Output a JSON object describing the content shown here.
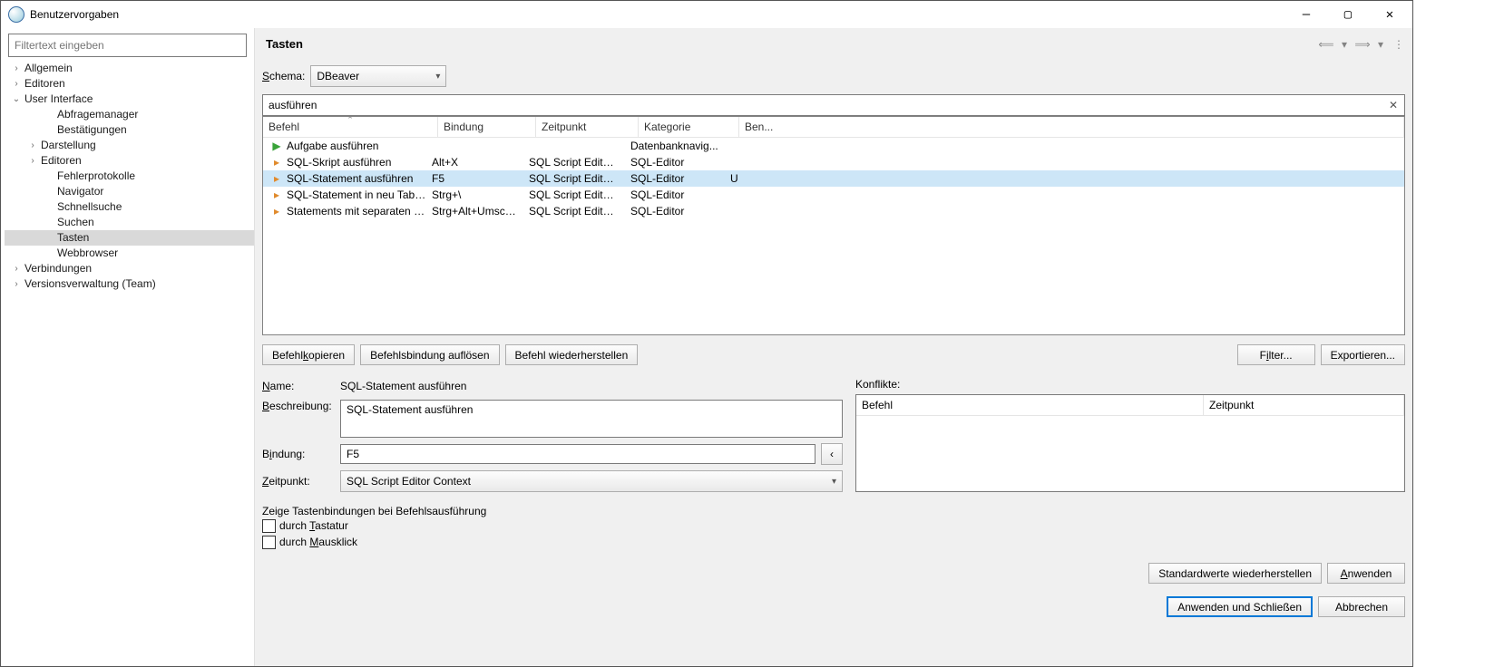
{
  "window": {
    "title": "Benutzervorgaben"
  },
  "sidebar": {
    "filter_placeholder": "Filtertext eingeben",
    "items": [
      {
        "label": "Allgemein",
        "depth": 0,
        "expander": ">"
      },
      {
        "label": "Editoren",
        "depth": 0,
        "expander": ">"
      },
      {
        "label": "User Interface",
        "depth": 0,
        "expander": "v"
      },
      {
        "label": "Abfragemanager",
        "depth": 2,
        "expander": ""
      },
      {
        "label": "Bestätigungen",
        "depth": 2,
        "expander": ""
      },
      {
        "label": "Darstellung",
        "depth": 1,
        "expander": ">"
      },
      {
        "label": "Editoren",
        "depth": 1,
        "expander": ">"
      },
      {
        "label": "Fehlerprotokolle",
        "depth": 2,
        "expander": ""
      },
      {
        "label": "Navigator",
        "depth": 2,
        "expander": ""
      },
      {
        "label": "Schnellsuche",
        "depth": 2,
        "expander": ""
      },
      {
        "label": "Suchen",
        "depth": 2,
        "expander": ""
      },
      {
        "label": "Tasten",
        "depth": 2,
        "expander": "",
        "selected": true
      },
      {
        "label": "Webbrowser",
        "depth": 2,
        "expander": ""
      },
      {
        "label": "Verbindungen",
        "depth": 0,
        "expander": ">"
      },
      {
        "label": "Versionsverwaltung (Team)",
        "depth": 0,
        "expander": ">"
      }
    ]
  },
  "page": {
    "title": "Tasten",
    "scheme_label": "Schema:",
    "scheme_value": "DBeaver",
    "search_value": "ausführen",
    "columns": {
      "cmd": "Befehl",
      "bind": "Bindung",
      "when": "Zeitpunkt",
      "cat": "Kategorie",
      "usr": "Ben..."
    },
    "rows": [
      {
        "icon": "play",
        "cmd": "Aufgabe ausführen",
        "bind": "",
        "when": "",
        "cat": "Datenbanknavig...",
        "usr": ""
      },
      {
        "icon": "sql",
        "cmd": "SQL-Skript ausführen",
        "bind": "Alt+X",
        "when": "SQL Script Editor...",
        "cat": "SQL-Editor",
        "usr": ""
      },
      {
        "icon": "sql",
        "cmd": "SQL-Statement ausführen",
        "bind": "F5",
        "when": "SQL Script Editor...",
        "cat": "SQL-Editor",
        "usr": "U",
        "selected": true
      },
      {
        "icon": "sql",
        "cmd": "SQL-Statement in neu Tab aus",
        "bind": "Strg+\\",
        "when": "SQL Script Editor...",
        "cat": "SQL-Editor",
        "usr": ""
      },
      {
        "icon": "sql",
        "cmd": "Statements mit separaten Erg",
        "bind": "Strg+Alt+Umsch...",
        "when": "SQL Script Editor...",
        "cat": "SQL-Editor",
        "usr": ""
      }
    ],
    "btns": {
      "copy": "Befehl kopieren",
      "unbind": "Befehlsbindung auflösen",
      "restore": "Befehl wiederherstellen",
      "filter": "Filter...",
      "export": "Exportieren..."
    },
    "detail": {
      "name_lbl": "Name:",
      "name_val": "SQL-Statement ausführen",
      "desc_lbl": "Beschreibung:",
      "desc_val": "SQL-Statement ausführen",
      "bind_lbl": "Bindung:",
      "bind_val": "F5",
      "when_lbl": "Zeitpunkt:",
      "when_val": "SQL Script Editor Context",
      "confl_lbl": "Konflikte:",
      "confl_cols": {
        "cmd": "Befehl",
        "when": "Zeitpunkt"
      }
    },
    "show": {
      "heading": "Zeige Tastenbindungen bei Befehlsausführung",
      "kb": "durch Tastatur",
      "mouse": "durch Mausklick"
    },
    "footer": {
      "defaults": "Standardwerte wiederherstellen",
      "apply": "Anwenden",
      "apply_close": "Anwenden und Schließen",
      "cancel": "Abbrechen"
    }
  }
}
